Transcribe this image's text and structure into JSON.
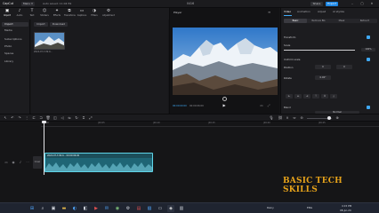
{
  "titlebar": {
    "app_name": "CapCut",
    "menu_label": "Menu ▾",
    "project_title": "Auto saved: 11:04:59",
    "center_label": "0416",
    "share_label": "Share",
    "export_label": "Export"
  },
  "toolbar": {
    "items": [
      {
        "label": "Import",
        "icon": "▣"
      },
      {
        "label": "Audio",
        "icon": "♪"
      },
      {
        "label": "Text",
        "icon": "T"
      },
      {
        "label": "Stickers",
        "icon": "☺"
      },
      {
        "label": "Effects",
        "icon": "✦"
      },
      {
        "label": "Transitions",
        "icon": "⧉"
      },
      {
        "label": "Captions",
        "icon": "▭"
      },
      {
        "label": "Filters",
        "icon": "◑"
      },
      {
        "label": "Adjustment",
        "icon": "⚙"
      }
    ]
  },
  "sidebar": {
    "items": [
      {
        "label": "Import"
      },
      {
        "label": "Media"
      },
      {
        "label": "Subscriptions"
      },
      {
        "label": "Photo"
      },
      {
        "label": "Spaces"
      },
      {
        "label": "Library"
      }
    ]
  },
  "media": {
    "import_label": "Import",
    "download_label": "Download",
    "thumb_label": "2024-07-3 09:0..."
  },
  "player": {
    "title": "Player",
    "time_current": "00:00:00:00",
    "time_total": "00:00:06:00"
  },
  "props": {
    "tabs": [
      {
        "label": "Video"
      },
      {
        "label": "Animation"
      },
      {
        "label": "Adjust"
      },
      {
        "label": "AI stylize"
      }
    ],
    "subtabs": [
      {
        "label": "Basic"
      },
      {
        "label": "Remove BG"
      },
      {
        "label": "Mask"
      },
      {
        "label": "Retouch"
      }
    ],
    "transform_label": "Transform",
    "scale_label": "Scale",
    "scale_value": "100%",
    "scale_level": 1.0,
    "uniform_label": "Uniform scale",
    "position_label": "Position",
    "pos_x": "0",
    "pos_y": "0",
    "rotate_label": "Rotate",
    "rotate_value": "0.00°",
    "blend_label": "Blend",
    "blend_value": "Normal",
    "accent": "#3fa9f5"
  },
  "timeline": {
    "ticks": [
      "00:00",
      "|00:05",
      "|00:10",
      "|00:15",
      "|00:20",
      "|00:25"
    ],
    "clip_label": "2024-07-3 09:0...  00:00:06:00",
    "cover_label": "Cover",
    "clip_color": "#1c4e5a"
  },
  "watermark": {
    "text": "BASIC TECH SKILLS",
    "color": "#e6a21a"
  },
  "taskbar": {
    "tray_text": "ENG",
    "time": "4:15 PM",
    "date": "08-Jul-24",
    "weather": "Rainy"
  }
}
